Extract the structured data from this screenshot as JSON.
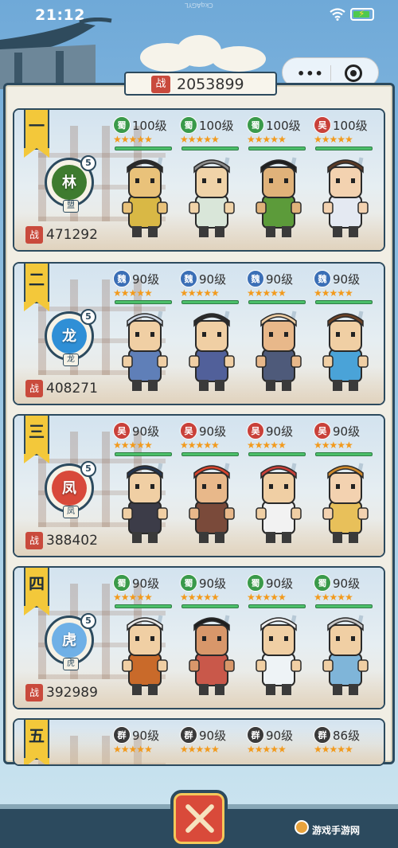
{
  "status": {
    "time": "21:12",
    "faint_text": "CkqAGYL"
  },
  "capsule": {
    "more": "•••"
  },
  "total_power": {
    "badge": "战",
    "value": "2053899"
  },
  "teams": [
    {
      "rank": "一",
      "emblem_glyph": "林",
      "emblem_level": "5",
      "emblem_sub": "盟",
      "emblem_color": "#3e7b2f",
      "power_badge": "战",
      "power": "471292",
      "heroes": [
        {
          "faction": "蜀",
          "faction_color": "#3a9a4a",
          "level": "100级",
          "stars": "★★★★★",
          "skin": "#e9c27a",
          "cloth": "#d9b845",
          "hair": "#2b2b2b"
        },
        {
          "faction": "蜀",
          "faction_color": "#3a9a4a",
          "level": "100级",
          "stars": "★★★★★",
          "skin": "#f0d3a8",
          "cloth": "#d9e6d9",
          "hair": "#8d8d8d"
        },
        {
          "faction": "蜀",
          "faction_color": "#3a9a4a",
          "level": "100级",
          "stars": "★★★★★",
          "skin": "#e0b27a",
          "cloth": "#5c9b3a",
          "hair": "#1f1f1f"
        },
        {
          "faction": "吴",
          "faction_color": "#c9413a",
          "level": "100级",
          "stars": "★★★★★",
          "skin": "#f3d2b0",
          "cloth": "#e4e9f2",
          "hair": "#5a3a26"
        }
      ]
    },
    {
      "rank": "二",
      "emblem_glyph": "龙",
      "emblem_level": "5",
      "emblem_sub": "龙",
      "emblem_color": "#2f8fd6",
      "power_badge": "战",
      "power": "408271",
      "heroes": [
        {
          "faction": "魏",
          "faction_color": "#3b6fb6",
          "level": "90级",
          "stars": "★★★★★",
          "skin": "#f0cfa4",
          "cloth": "#5f7fb8",
          "hair": "#cfd9e6"
        },
        {
          "faction": "魏",
          "faction_color": "#3b6fb6",
          "level": "90级",
          "stars": "★★★★★",
          "skin": "#f0cfa4",
          "cloth": "#51609a",
          "hair": "#2b2b2b"
        },
        {
          "faction": "魏",
          "faction_color": "#3b6fb6",
          "level": "90级",
          "stars": "★★★★★",
          "skin": "#e8b88a",
          "cloth": "#4e5a7a",
          "hair": "#f0cfa4"
        },
        {
          "faction": "魏",
          "faction_color": "#3b6fb6",
          "level": "90级",
          "stars": "★★★★★",
          "skin": "#f0cfa4",
          "cloth": "#4aa3d8",
          "hair": "#6b4226"
        }
      ]
    },
    {
      "rank": "三",
      "emblem_glyph": "凤",
      "emblem_level": "5",
      "emblem_sub": "凤",
      "emblem_color": "#d8493a",
      "power_badge": "战",
      "power": "388402",
      "heroes": [
        {
          "faction": "吴",
          "faction_color": "#c9413a",
          "level": "90级",
          "stars": "★★★★★",
          "skin": "#f0cfa4",
          "cloth": "#3c3c48",
          "hair": "#24344d"
        },
        {
          "faction": "吴",
          "faction_color": "#c9413a",
          "level": "90级",
          "stars": "★★★★★",
          "skin": "#e8b88a",
          "cloth": "#7a4a3a",
          "hair": "#d8452e"
        },
        {
          "faction": "吴",
          "faction_color": "#c9413a",
          "level": "90级",
          "stars": "★★★★★",
          "skin": "#f0cfa4",
          "cloth": "#f2f2f2",
          "hair": "#c9413a"
        },
        {
          "faction": "吴",
          "faction_color": "#c9413a",
          "level": "90级",
          "stars": "★★★★★",
          "skin": "#f3d2b0",
          "cloth": "#e8c05a",
          "hair": "#d08a2c"
        }
      ]
    },
    {
      "rank": "四",
      "emblem_glyph": "虎",
      "emblem_level": "5",
      "emblem_sub": "虎",
      "emblem_color": "#6fb0e6",
      "power_badge": "战",
      "power": "392989",
      "heroes": [
        {
          "faction": "蜀",
          "faction_color": "#3a9a4a",
          "level": "90级",
          "stars": "★★★★★",
          "skin": "#f0cfa4",
          "cloth": "#c96a2a",
          "hair": "#e9e9e9"
        },
        {
          "faction": "蜀",
          "faction_color": "#3a9a4a",
          "level": "90级",
          "stars": "★★★★★",
          "skin": "#d8976a",
          "cloth": "#c9584a",
          "hair": "#1f1f1f"
        },
        {
          "faction": "蜀",
          "faction_color": "#3a9a4a",
          "level": "90级",
          "stars": "★★★★★",
          "skin": "#f0cfa4",
          "cloth": "#eef3f6",
          "hair": "#f0f0f0"
        },
        {
          "faction": "蜀",
          "faction_color": "#3a9a4a",
          "level": "90级",
          "stars": "★★★★★",
          "skin": "#f0cfa4",
          "cloth": "#7fb5d9",
          "hair": "#c8c8c8"
        }
      ]
    },
    {
      "rank": "五",
      "emblem_glyph": "",
      "emblem_level": "",
      "emblem_sub": "",
      "emblem_color": "#888888",
      "power_badge": "",
      "power": "",
      "heroes": [
        {
          "faction": "群",
          "faction_color": "#3a3a3a",
          "level": "90级",
          "stars": "★★★★★",
          "skin": "",
          "cloth": "",
          "hair": ""
        },
        {
          "faction": "群",
          "faction_color": "#3a3a3a",
          "level": "90级",
          "stars": "★★★★★",
          "skin": "",
          "cloth": "",
          "hair": ""
        },
        {
          "faction": "群",
          "faction_color": "#3a3a3a",
          "level": "90级",
          "stars": "★★★★★",
          "skin": "",
          "cloth": "",
          "hair": ""
        },
        {
          "faction": "群",
          "faction_color": "#3a3a3a",
          "level": "86级",
          "stars": "★★★★★",
          "skin": "",
          "cloth": "",
          "hair": ""
        }
      ]
    }
  ],
  "nav": {
    "center_icon": "crossed-swords-icon"
  },
  "watermark": "游戏手游网"
}
